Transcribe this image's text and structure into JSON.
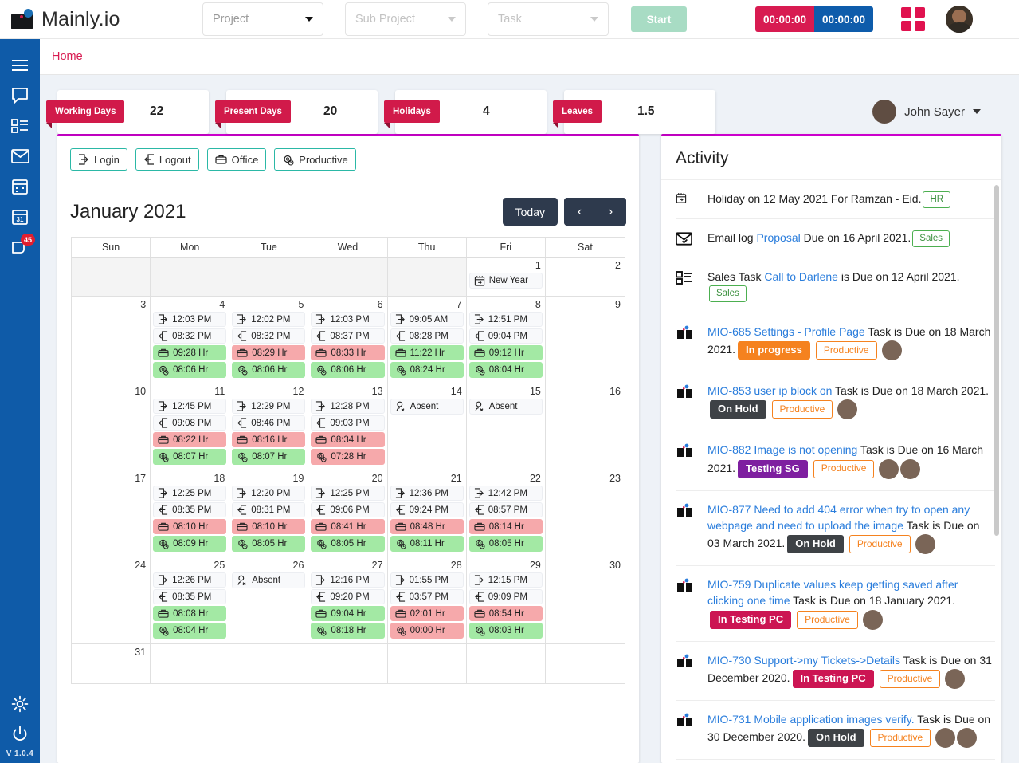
{
  "brand": {
    "name": "Mainly.io",
    "logo_icon": "book-logo-icon"
  },
  "topbar": {
    "project_placeholder": "Project",
    "subproject_placeholder": "Sub Project",
    "task_placeholder": "Task",
    "start_label": "Start",
    "timer_red": "00:00:00",
    "timer_blue": "00:00:00",
    "apps_icon": "grid-apps-icon",
    "avatar": "user-avatar",
    "colors": {
      "timer_red": "#d81b51",
      "timer_blue": "#0e5cab",
      "start": "#a8dcc4",
      "apps": "#e0124f"
    }
  },
  "sidebar": {
    "items": [
      {
        "icon": "hamburger-menu-icon",
        "name": "menu"
      },
      {
        "icon": "chat-bubble-icon",
        "name": "chat"
      },
      {
        "icon": "task-list-icon",
        "name": "tasks"
      },
      {
        "icon": "envelope-icon",
        "name": "mail"
      },
      {
        "icon": "calendar-grid-icon",
        "name": "calendar"
      },
      {
        "icon": "calendar-31-icon",
        "name": "schedule"
      },
      {
        "icon": "notes-icon",
        "name": "notes",
        "badge": "45"
      }
    ],
    "bottom": [
      {
        "icon": "gear-icon",
        "name": "settings"
      },
      {
        "icon": "power-icon",
        "name": "logout"
      }
    ],
    "version": "V 1.0.4",
    "bg_color": "#0f5ba8"
  },
  "breadcrumb": {
    "label": "Home",
    "color": "#d81b51"
  },
  "stats": [
    {
      "label": "Working Days",
      "value": "22"
    },
    {
      "label": "Present Days",
      "value": "20"
    },
    {
      "label": "Holidays",
      "value": "4"
    },
    {
      "label": "Leaves",
      "value": "1.5"
    }
  ],
  "user": {
    "name": "John Sayer",
    "avatar": "user-avatar",
    "caret": "chevron-down-icon"
  },
  "calendar": {
    "legend": [
      {
        "label": "Login",
        "icon": "login-arrow-icon"
      },
      {
        "label": "Logout",
        "icon": "logout-arrow-icon"
      },
      {
        "label": "Office",
        "icon": "briefcase-icon"
      },
      {
        "label": "Productive",
        "icon": "gear-clock-icon"
      }
    ],
    "title": "January 2021",
    "today_label": "Today",
    "prev_label": "‹",
    "next_label": "›",
    "dow": [
      "Sun",
      "Mon",
      "Tue",
      "Wed",
      "Thu",
      "Fri",
      "Sat"
    ],
    "weeks": [
      [
        {
          "day": "",
          "muted": true,
          "events": []
        },
        {
          "day": "",
          "muted": true,
          "events": []
        },
        {
          "day": "",
          "muted": true,
          "events": []
        },
        {
          "day": "",
          "muted": true,
          "events": []
        },
        {
          "day": "",
          "muted": true,
          "events": []
        },
        {
          "day": "1",
          "events": [
            {
              "icon": "calendar-event-icon",
              "text": "New Year",
              "style": "plain"
            }
          ]
        },
        {
          "day": "2",
          "events": []
        }
      ],
      [
        {
          "day": "3",
          "events": []
        },
        {
          "day": "4",
          "events": [
            {
              "icon": "login-arrow-icon",
              "text": "12:03 PM",
              "style": "plain"
            },
            {
              "icon": "logout-arrow-icon",
              "text": "08:32 PM",
              "style": "plain"
            },
            {
              "icon": "briefcase-icon",
              "text": "09:28 Hr",
              "style": "green"
            },
            {
              "icon": "gear-clock-icon",
              "text": "08:06 Hr",
              "style": "green"
            }
          ]
        },
        {
          "day": "5",
          "events": [
            {
              "icon": "login-arrow-icon",
              "text": "12:02 PM",
              "style": "plain"
            },
            {
              "icon": "logout-arrow-icon",
              "text": "08:32 PM",
              "style": "plain"
            },
            {
              "icon": "briefcase-icon",
              "text": "08:29 Hr",
              "style": "red"
            },
            {
              "icon": "gear-clock-icon",
              "text": "08:06 Hr",
              "style": "green"
            }
          ]
        },
        {
          "day": "6",
          "events": [
            {
              "icon": "login-arrow-icon",
              "text": "12:03 PM",
              "style": "plain"
            },
            {
              "icon": "logout-arrow-icon",
              "text": "08:37 PM",
              "style": "plain"
            },
            {
              "icon": "briefcase-icon",
              "text": "08:33 Hr",
              "style": "red"
            },
            {
              "icon": "gear-clock-icon",
              "text": "08:06 Hr",
              "style": "green"
            }
          ]
        },
        {
          "day": "7",
          "events": [
            {
              "icon": "login-arrow-icon",
              "text": "09:05 AM",
              "style": "plain"
            },
            {
              "icon": "logout-arrow-icon",
              "text": "08:28 PM",
              "style": "plain"
            },
            {
              "icon": "briefcase-icon",
              "text": "11:22 Hr",
              "style": "green"
            },
            {
              "icon": "gear-clock-icon",
              "text": "08:24 Hr",
              "style": "green"
            }
          ]
        },
        {
          "day": "8",
          "events": [
            {
              "icon": "login-arrow-icon",
              "text": "12:51 PM",
              "style": "plain"
            },
            {
              "icon": "logout-arrow-icon",
              "text": "09:04 PM",
              "style": "plain"
            },
            {
              "icon": "briefcase-icon",
              "text": "09:12 Hr",
              "style": "green"
            },
            {
              "icon": "gear-clock-icon",
              "text": "08:04 Hr",
              "style": "green"
            }
          ]
        },
        {
          "day": "9",
          "events": []
        }
      ],
      [
        {
          "day": "10",
          "events": []
        },
        {
          "day": "11",
          "events": [
            {
              "icon": "login-arrow-icon",
              "text": "12:45 PM",
              "style": "plain"
            },
            {
              "icon": "logout-arrow-icon",
              "text": "09:08 PM",
              "style": "plain"
            },
            {
              "icon": "briefcase-icon",
              "text": "08:22 Hr",
              "style": "red"
            },
            {
              "icon": "gear-clock-icon",
              "text": "08:07 Hr",
              "style": "green"
            }
          ]
        },
        {
          "day": "12",
          "events": [
            {
              "icon": "login-arrow-icon",
              "text": "12:29 PM",
              "style": "plain"
            },
            {
              "icon": "logout-arrow-icon",
              "text": "08:46 PM",
              "style": "plain"
            },
            {
              "icon": "briefcase-icon",
              "text": "08:16 Hr",
              "style": "red"
            },
            {
              "icon": "gear-clock-icon",
              "text": "08:07 Hr",
              "style": "green"
            }
          ]
        },
        {
          "day": "13",
          "events": [
            {
              "icon": "login-arrow-icon",
              "text": "12:28 PM",
              "style": "plain"
            },
            {
              "icon": "logout-arrow-icon",
              "text": "09:03 PM",
              "style": "plain"
            },
            {
              "icon": "briefcase-icon",
              "text": "08:34 Hr",
              "style": "red"
            },
            {
              "icon": "gear-clock-icon",
              "text": "07:28 Hr",
              "style": "red"
            }
          ]
        },
        {
          "day": "14",
          "events": [
            {
              "icon": "absent-user-icon",
              "text": "Absent",
              "style": "plain"
            }
          ]
        },
        {
          "day": "15",
          "events": [
            {
              "icon": "absent-user-icon",
              "text": "Absent",
              "style": "plain"
            }
          ]
        },
        {
          "day": "16",
          "events": []
        }
      ],
      [
        {
          "day": "17",
          "events": []
        },
        {
          "day": "18",
          "events": [
            {
              "icon": "login-arrow-icon",
              "text": "12:25 PM",
              "style": "plain"
            },
            {
              "icon": "logout-arrow-icon",
              "text": "08:35 PM",
              "style": "plain"
            },
            {
              "icon": "briefcase-icon",
              "text": "08:10 Hr",
              "style": "red"
            },
            {
              "icon": "gear-clock-icon",
              "text": "08:09 Hr",
              "style": "green"
            }
          ]
        },
        {
          "day": "19",
          "events": [
            {
              "icon": "login-arrow-icon",
              "text": "12:20 PM",
              "style": "plain"
            },
            {
              "icon": "logout-arrow-icon",
              "text": "08:31 PM",
              "style": "plain"
            },
            {
              "icon": "briefcase-icon",
              "text": "08:10 Hr",
              "style": "red"
            },
            {
              "icon": "gear-clock-icon",
              "text": "08:05 Hr",
              "style": "green"
            }
          ]
        },
        {
          "day": "20",
          "events": [
            {
              "icon": "login-arrow-icon",
              "text": "12:25 PM",
              "style": "plain"
            },
            {
              "icon": "logout-arrow-icon",
              "text": "09:06 PM",
              "style": "plain"
            },
            {
              "icon": "briefcase-icon",
              "text": "08:41 Hr",
              "style": "red"
            },
            {
              "icon": "gear-clock-icon",
              "text": "08:05 Hr",
              "style": "green"
            }
          ]
        },
        {
          "day": "21",
          "events": [
            {
              "icon": "login-arrow-icon",
              "text": "12:36 PM",
              "style": "plain"
            },
            {
              "icon": "logout-arrow-icon",
              "text": "09:24 PM",
              "style": "plain"
            },
            {
              "icon": "briefcase-icon",
              "text": "08:48 Hr",
              "style": "red"
            },
            {
              "icon": "gear-clock-icon",
              "text": "08:11 Hr",
              "style": "green"
            }
          ]
        },
        {
          "day": "22",
          "events": [
            {
              "icon": "login-arrow-icon",
              "text": "12:42 PM",
              "style": "plain"
            },
            {
              "icon": "logout-arrow-icon",
              "text": "08:57 PM",
              "style": "plain"
            },
            {
              "icon": "briefcase-icon",
              "text": "08:14 Hr",
              "style": "red"
            },
            {
              "icon": "gear-clock-icon",
              "text": "08:05 Hr",
              "style": "green"
            }
          ]
        },
        {
          "day": "23",
          "events": []
        }
      ],
      [
        {
          "day": "24",
          "events": []
        },
        {
          "day": "25",
          "events": [
            {
              "icon": "login-arrow-icon",
              "text": "12:26 PM",
              "style": "plain"
            },
            {
              "icon": "logout-arrow-icon",
              "text": "08:35 PM",
              "style": "plain"
            },
            {
              "icon": "briefcase-icon",
              "text": "08:08 Hr",
              "style": "green"
            },
            {
              "icon": "gear-clock-icon",
              "text": "08:04 Hr",
              "style": "green"
            }
          ]
        },
        {
          "day": "26",
          "events": [
            {
              "icon": "absent-user-icon",
              "text": "Absent",
              "style": "plain"
            }
          ]
        },
        {
          "day": "27",
          "events": [
            {
              "icon": "login-arrow-icon",
              "text": "12:16 PM",
              "style": "plain"
            },
            {
              "icon": "logout-arrow-icon",
              "text": "09:20 PM",
              "style": "plain"
            },
            {
              "icon": "briefcase-icon",
              "text": "09:04 Hr",
              "style": "green"
            },
            {
              "icon": "gear-clock-icon",
              "text": "08:18 Hr",
              "style": "green"
            }
          ]
        },
        {
          "day": "28",
          "events": [
            {
              "icon": "login-arrow-icon",
              "text": "01:55 PM",
              "style": "plain"
            },
            {
              "icon": "logout-arrow-icon",
              "text": "03:57 PM",
              "style": "plain"
            },
            {
              "icon": "briefcase-icon",
              "text": "02:01 Hr",
              "style": "red"
            },
            {
              "icon": "gear-clock-icon",
              "text": "00:00 Hr",
              "style": "red"
            }
          ]
        },
        {
          "day": "29",
          "events": [
            {
              "icon": "login-arrow-icon",
              "text": "12:15 PM",
              "style": "plain"
            },
            {
              "icon": "logout-arrow-icon",
              "text": "09:09 PM",
              "style": "plain"
            },
            {
              "icon": "briefcase-icon",
              "text": "08:54 Hr",
              "style": "red"
            },
            {
              "icon": "gear-clock-icon",
              "text": "08:03 Hr",
              "style": "green"
            }
          ]
        },
        {
          "day": "30",
          "events": []
        }
      ],
      [
        {
          "day": "31",
          "events": []
        },
        {
          "day": "",
          "events": []
        },
        {
          "day": "",
          "events": []
        },
        {
          "day": "",
          "events": []
        },
        {
          "day": "",
          "events": []
        },
        {
          "day": "",
          "events": []
        },
        {
          "day": "",
          "events": []
        }
      ]
    ]
  },
  "activity": {
    "title": "Activity",
    "items": [
      {
        "icon": "calendar-event-icon",
        "parts": [
          {
            "t": "Holiday on 12 May 2021 For Ramzan - Eid.",
            "k": "text"
          }
        ],
        "pill": "HR",
        "chip": null,
        "chip_style": null,
        "tag": null,
        "avatars": 0
      },
      {
        "icon": "envelope-check-icon",
        "parts": [
          {
            "t": "Email log ",
            "k": "text"
          },
          {
            "t": "Proposal",
            "k": "link"
          },
          {
            "t": " Due on 16 April 2021.",
            "k": "text"
          }
        ],
        "pill": "Sales",
        "chip": null,
        "chip_style": null,
        "tag": null,
        "avatars": 0
      },
      {
        "icon": "task-list-icon",
        "parts": [
          {
            "t": "Sales Task ",
            "k": "text"
          },
          {
            "t": "Call to Darlene",
            "k": "link"
          },
          {
            "t": " is Due on 12 April 2021.",
            "k": "text"
          }
        ],
        "pill": "Sales",
        "chip": null,
        "chip_style": null,
        "tag": null,
        "avatars": 0
      },
      {
        "icon": "task-board-icon",
        "parts": [
          {
            "t": "MIO-685 Settings - Profile Page",
            "k": "link"
          },
          {
            "t": " Task is Due on 18 March 2021.",
            "k": "text"
          }
        ],
        "pill": null,
        "chip": "In progress",
        "chip_style": "orange",
        "tag": "Productive",
        "avatars": 1
      },
      {
        "icon": "task-board-icon",
        "parts": [
          {
            "t": "MIO-853 user ip block on",
            "k": "link"
          },
          {
            "t": " Task is Due on 18 March 2021.",
            "k": "text"
          }
        ],
        "pill": null,
        "chip": "On Hold",
        "chip_style": "dark",
        "tag": "Productive",
        "avatars": 1
      },
      {
        "icon": "task-board-icon",
        "parts": [
          {
            "t": "MIO-882 Image is not opening",
            "k": "link"
          },
          {
            "t": " Task is Due on 16 March 2021.",
            "k": "text"
          }
        ],
        "pill": null,
        "chip": "Testing SG",
        "chip_style": "purple",
        "tag": "Productive",
        "avatars": 2
      },
      {
        "icon": "task-board-icon",
        "parts": [
          {
            "t": "MIO-877 Need to add 404 error when try to open any webpage and need to upload the image",
            "k": "link"
          },
          {
            "t": " Task is Due on 03 March 2021.",
            "k": "text"
          }
        ],
        "pill": null,
        "chip": "On Hold",
        "chip_style": "dark",
        "tag": "Productive",
        "avatars": 1
      },
      {
        "icon": "task-board-icon",
        "parts": [
          {
            "t": "MIO-759 Duplicate values keep getting saved after clicking one time",
            "k": "link"
          },
          {
            "t": " Task is Due on 18 January 2021.",
            "k": "text"
          }
        ],
        "pill": null,
        "chip": "In Testing PC",
        "chip_style": "pink",
        "tag": "Productive",
        "avatars": 1
      },
      {
        "icon": "task-board-icon",
        "parts": [
          {
            "t": "MIO-730 Support->my Tickets->Details",
            "k": "link"
          },
          {
            "t": " Task is Due on 31 December 2020.",
            "k": "text"
          }
        ],
        "pill": null,
        "chip": "In Testing PC",
        "chip_style": "pink",
        "tag": "Productive",
        "avatars": 1
      },
      {
        "icon": "task-board-icon",
        "parts": [
          {
            "t": "MIO-731 Mobile application images verify.",
            "k": "link"
          },
          {
            "t": " Task is Due on 30 December 2020.",
            "k": "text"
          }
        ],
        "pill": null,
        "chip": "On Hold",
        "chip_style": "dark",
        "tag": "Productive",
        "avatars": 2
      }
    ]
  }
}
